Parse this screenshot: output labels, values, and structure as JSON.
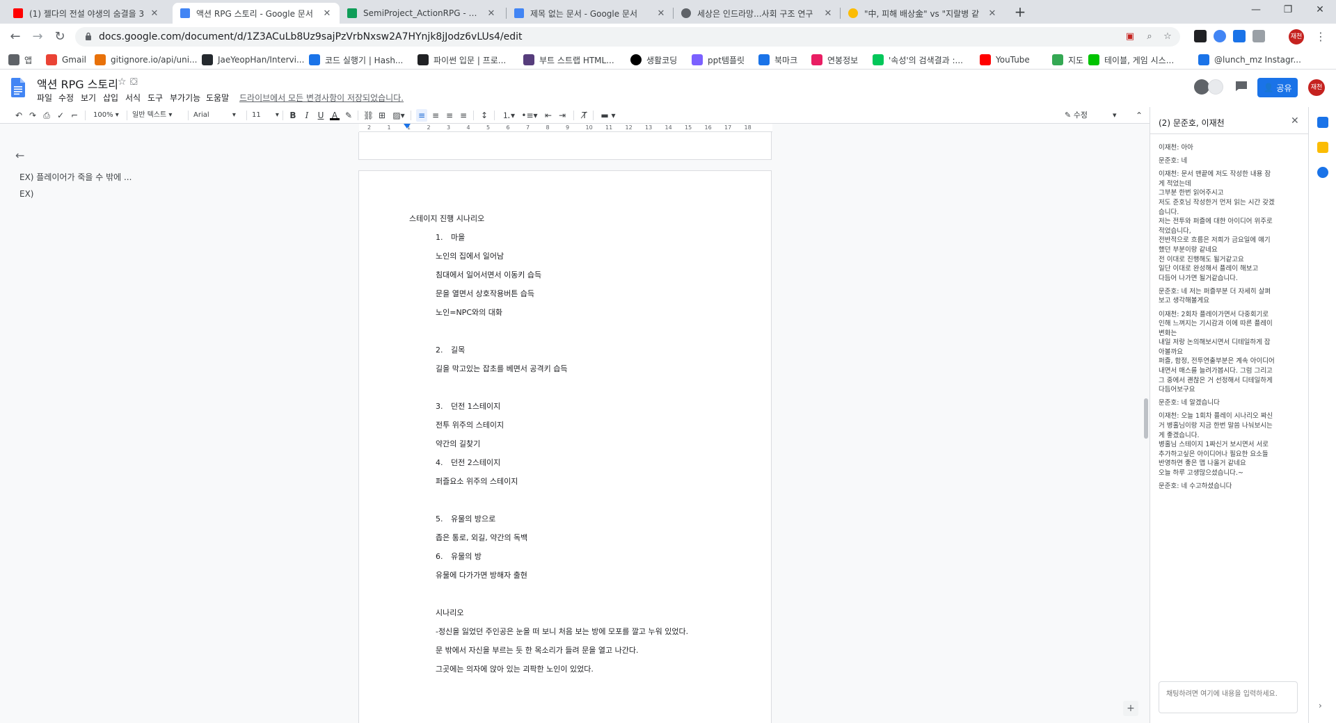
{
  "browser": {
    "tabs": [
      {
        "title": "(1) 젤다의 전설 야생의 숨결을 3",
        "favicon": "youtube-icon",
        "active": false
      },
      {
        "title": "액션 RPG 스토리 - Google 문서",
        "favicon": "google-docs-icon",
        "active": true
      },
      {
        "title": "SemiProject_ActionRPG - Googl",
        "favicon": "google-sheets-icon",
        "active": false
      },
      {
        "title": "제목 없는 문서 - Google 문서",
        "favicon": "google-docs-icon",
        "active": false
      },
      {
        "title": "세상은 인드라망...사회 구조 연구",
        "favicon": "globe-icon",
        "active": false
      },
      {
        "title": "\"中, 피해 배상金\" vs \"지랄병 같",
        "favicon": "news-icon",
        "active": false
      }
    ],
    "url": "docs.google.com/document/d/1Z3ACuLb8Uz9sajPzVrbNxsw2A7HYnjk8jJodz6vLUs4/edit",
    "profile_label": "재천"
  },
  "bookmarks": [
    {
      "label": "앱",
      "icon": "apps-grid-icon",
      "color": "#5f6368"
    },
    {
      "label": "Gmail",
      "icon": "gmail-icon",
      "color": "#ea4335"
    },
    {
      "label": "gitignore.io/api/uni...",
      "icon": "gitignore-icon",
      "color": "#e8710a"
    },
    {
      "label": "JaeYeopHan/Intervi...",
      "icon": "github-icon",
      "color": "#24292e"
    },
    {
      "label": "코드 실행기 | Hash...",
      "icon": "hash-icon",
      "color": "#1a73e8"
    },
    {
      "label": "파이썬 입문 | 프로...",
      "icon": "python-book-icon",
      "color": "#202124"
    },
    {
      "label": "부트 스트랩 HTML...",
      "icon": "bootstrap-icon",
      "color": "#563d7c"
    },
    {
      "label": "생활코딩",
      "icon": "circle-icon",
      "color": "#000000"
    },
    {
      "label": "ppt템플릿",
      "icon": "ppt-icon",
      "color": "#7b61ff"
    },
    {
      "label": "북마크",
      "icon": "star-icon",
      "color": "#1a73e8"
    },
    {
      "label": "연봉정보",
      "icon": "salary-icon",
      "color": "#e91e63"
    },
    {
      "label": "'속성'의 검색결과 :...",
      "icon": "naver-icon",
      "color": "#03c75a"
    },
    {
      "label": "YouTube",
      "icon": "youtube-icon",
      "color": "#ff0000"
    },
    {
      "label": "지도",
      "icon": "maps-icon",
      "color": "#34a853"
    },
    {
      "label": "테이블, 게임 시스...",
      "icon": "line-icon",
      "color": "#00c300"
    },
    {
      "label": "@lunch_mz Instagr...",
      "icon": "instagram-icon",
      "color": "#1a73e8"
    }
  ],
  "docs": {
    "title": "액션 RPG 스토리",
    "menus": [
      "파일",
      "수정",
      "보기",
      "삽입",
      "서식",
      "도구",
      "부가기능",
      "도움말"
    ],
    "save_status": "드라이브에서 모든 변경사항이 저장되었습니다.",
    "share_label": "공유",
    "avatar_label": "재천"
  },
  "toolbar": {
    "zoom": "100%",
    "style": "일반 텍스트",
    "font": "Arial",
    "font_size": "11",
    "mode": "수정"
  },
  "ruler": [
    "2",
    "1",
    "1",
    "2",
    "3",
    "4",
    "5",
    "6",
    "7",
    "8",
    "9",
    "10",
    "11",
    "12",
    "13",
    "14",
    "15",
    "16",
    "17",
    "18"
  ],
  "outline": {
    "items": [
      "EX) 플레이어가 죽을 수 밖에 ...",
      "EX)"
    ]
  },
  "document": {
    "lines": [
      {
        "text": "스테이지 진행 시나리오",
        "indent": 0,
        "num": ""
      },
      {
        "text": "마을",
        "indent": 1,
        "num": "1."
      },
      {
        "text": "노인의 집에서 일어남",
        "indent": 1,
        "num": ""
      },
      {
        "text": "침대에서 일어서면서 이동키 습득",
        "indent": 1,
        "num": ""
      },
      {
        "text": "문을 열면서 상호작용버튼 습득",
        "indent": 1,
        "num": ""
      },
      {
        "text": "노인=NPC와의 대화",
        "indent": 1,
        "num": ""
      },
      {
        "text": "",
        "indent": 1,
        "num": ""
      },
      {
        "text": "길목",
        "indent": 1,
        "num": "2."
      },
      {
        "text": "길을 막고있는 잡초를 베면서 공격키 습득",
        "indent": 1,
        "num": ""
      },
      {
        "text": "",
        "indent": 1,
        "num": ""
      },
      {
        "text": "던전 1스테이지",
        "indent": 1,
        "num": "3."
      },
      {
        "text": "전투 위주의 스테이지",
        "indent": 1,
        "num": ""
      },
      {
        "text": "약간의 길찾기",
        "indent": 1,
        "num": ""
      },
      {
        "text": "던전 2스테이지",
        "indent": 1,
        "num": "4."
      },
      {
        "text": "퍼즐요소 위주의 스테이지",
        "indent": 1,
        "num": ""
      },
      {
        "text": "",
        "indent": 1,
        "num": ""
      },
      {
        "text": "유물의 방으로",
        "indent": 1,
        "num": "5."
      },
      {
        "text": "좁은 통로, 외길, 약간의 독백",
        "indent": 1,
        "num": ""
      },
      {
        "text": "유물의 방",
        "indent": 1,
        "num": "6."
      },
      {
        "text": "유물에 다가가면 방해자 출현",
        "indent": 1,
        "num": ""
      },
      {
        "text": "",
        "indent": 1,
        "num": ""
      },
      {
        "text": "시나리오",
        "indent": 1,
        "num": ""
      },
      {
        "text": "-정신을 잃었던 주인공은 눈을 떠 보니 처음 보는 방에 모포를 깔고 누워 있었다.",
        "indent": 1,
        "num": ""
      },
      {
        "text": "문 밖에서 자신을 부르는 듯 한 목소리가 들려 문을 열고 나간다.",
        "indent": 1,
        "num": ""
      },
      {
        "text": "그곳에는 의자에 앉아 있는 괴팍한 노인이 있었다.",
        "indent": 1,
        "num": ""
      }
    ]
  },
  "chat": {
    "title": "(2) 문준호, 이재천",
    "messages": [
      "이재천: 아아",
      "문준호: 네",
      "이재천: 문서 맨끝에 저도 작성한 내용 잠\n게 적었는데\n그부분 한번 읽어주시고\n저도 준호님 작성한거 먼저 읽는 시간 갖겠\n습니다.\n저는 전투와 퍼즐에 대한 아이디어 위주로\n적었습니다,\n전반적으로 흐름은 저희가 금요일에 얘기\n했던 부분이랑 같네요\n전 이대로 진행해도 될거같고요\n일단 이대로 완성해서 플레이 해보고\n다듬어 나가면 될거같습니다.",
      "문준호: 네 저는 퍼즐부분 더 자세히 살펴\n보고 생각해볼게요",
      "이재천: 2회차 플레이가면서 다중회기로\n인해 느껴지는 기시감과 이에 따른 플레이\n변화는\n내일 저랑 논의해보시면서 디테일하게 잡\n아볼까요\n퍼즐, 함정, 전투연출부분은 계속 아이디어\n내면서 매스를 늘려가봅시다. 그럼 그리고\n그 중에서 괜찮은 거 선정해서 디테일하게\n다듬어보구요",
      "문준호: 네 알겠습니다",
      "이재천: 오늘 1회차 플레이 시나리오 짜신\n거 병홀님이랑 지금 한번 말씀 나눠보시는\n게 좋겠습니다.\n병홀님 스테이지 1짜신거 보시면서 서로\n추가하고싶은 아이디어나 필요한 요소들\n반영하면 좋은 맵 나올거 같네요\n오늘 하루 고생많으셨습니다.~",
      "문준호: 네 수고하셨습니다"
    ],
    "input_placeholder": "채팅하려면 여기에 내용을 입력하세요."
  }
}
